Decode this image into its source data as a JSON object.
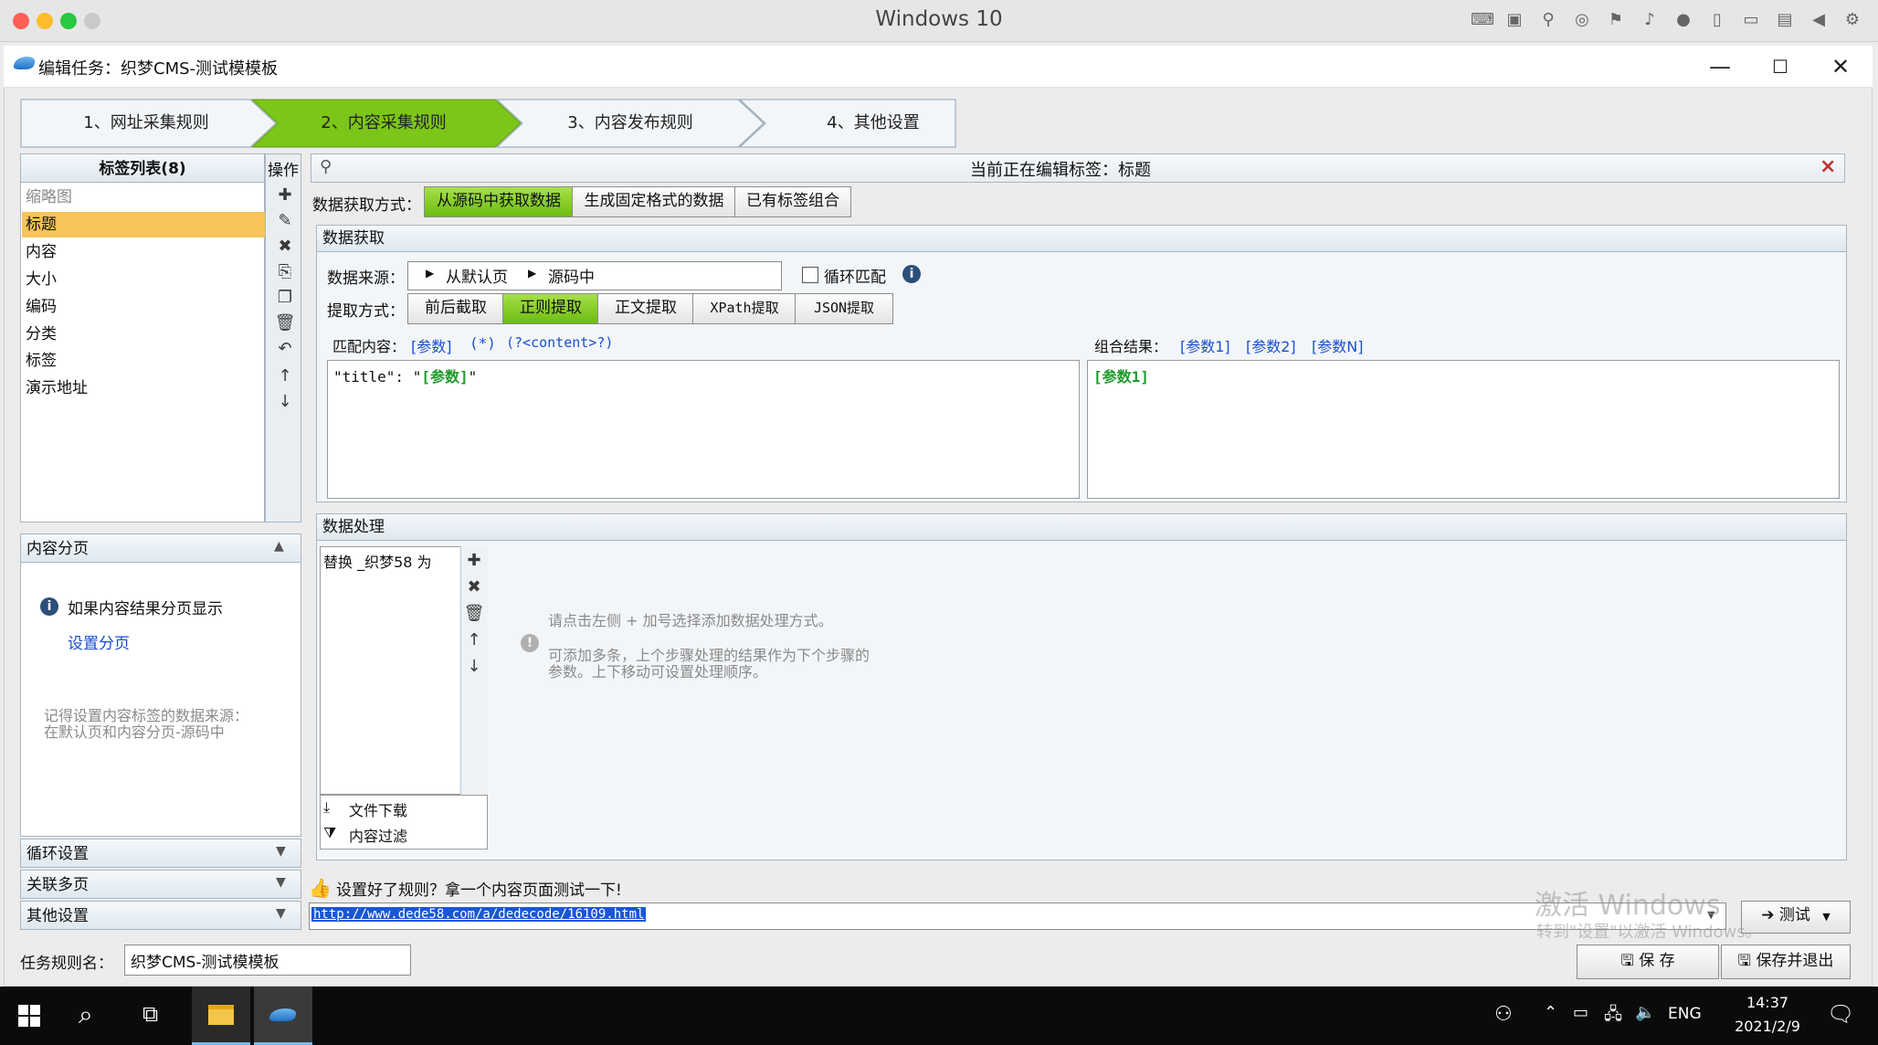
{
  "host": {
    "title": "Windows 10"
  },
  "window": {
    "title": "编辑任务：织梦CMS-测试模模板",
    "minimize": "—",
    "maximize": "☐",
    "close": "✕"
  },
  "wizard": {
    "steps": [
      {
        "label": "1、网址采集规则"
      },
      {
        "label": "2、内容采集规则"
      },
      {
        "label": "3、内容发布规则"
      },
      {
        "label": "4、其他设置"
      }
    ]
  },
  "tag_list": {
    "header": "标签列表(8)",
    "ops_header": "操作",
    "items": [
      "缩略图",
      "标题",
      "内容",
      "大小",
      "编码",
      "分类",
      "标签",
      "演示地址"
    ],
    "selected": "标题"
  },
  "pagination": {
    "header": "内容分页",
    "info": "如果内容结果分页显示",
    "link": "设置分页",
    "note_line1": "记得设置内容标签的数据来源：",
    "note_line2": "在默认页和内容分页-源码中"
  },
  "collapsibles": [
    {
      "label": "循环设置"
    },
    {
      "label": "关联多页"
    },
    {
      "label": "其他设置"
    }
  ],
  "editor": {
    "current_label": "当前正在编辑标签：标题",
    "close_x": "×",
    "fetch_mode_label": "数据获取方式：",
    "fetch_modes": [
      "从源码中获取数据",
      "生成固定格式的数据",
      "已有标签组合"
    ],
    "fetch_mode_selected": "从源码中获取数据",
    "acquire_header": "数据获取",
    "source_label": "数据来源：",
    "source_part1": "从默认页",
    "source_part2": "源码中",
    "loop_match": "循环匹配",
    "extract_label": "提取方式：",
    "extract_modes": [
      "前后截取",
      "正则提取",
      "正文提取",
      "XPath提取",
      "JSON提取"
    ],
    "extract_selected": "正则提取",
    "match_label": "匹配内容：",
    "match_tokens": [
      "[参数]",
      "(*)",
      "(?<content>?)"
    ],
    "match_text_prefix": "\"title\": \"",
    "match_text_param": "[参数]",
    "match_text_suffix": "\"",
    "combine_label": "组合结果：",
    "combine_tokens": [
      "[参数1]",
      "[参数2]",
      "[参数N]"
    ],
    "combine_text": "[参数1]"
  },
  "processing": {
    "header": "数据处理",
    "items": [
      "替换 _织梦58 为"
    ],
    "hint1": "请点击左侧 + 加号选择添加数据处理方式。",
    "hint2": "可添加多条，上个步骤处理的结果作为下个步骤的",
    "hint3": "参数。上下移动可设置处理顺序。",
    "file_download": "文件下载",
    "content_filter": "内容过滤"
  },
  "test": {
    "prompt": "设置好了规则？拿一个内容页面测试一下!",
    "url": "http://www.dede58.com/a/dedecode/16109.html",
    "test_button": "测试"
  },
  "footer": {
    "task_name_label": "任务规则名：",
    "task_name_value": "织梦CMS-测试模模板",
    "save": "保 存",
    "save_exit": "保存并退出",
    "watermark1": "激活 Windows",
    "watermark2": "转到\"设置\"以激活 Windows。"
  },
  "taskbar": {
    "lang": "ENG",
    "time": "14:37",
    "date": "2021/2/9"
  },
  "colors": {
    "accent_green": "#7cc61a",
    "selected_item": "#f7c35a",
    "link_blue": "#1a4fd1",
    "param_green": "#1f9a2c"
  }
}
